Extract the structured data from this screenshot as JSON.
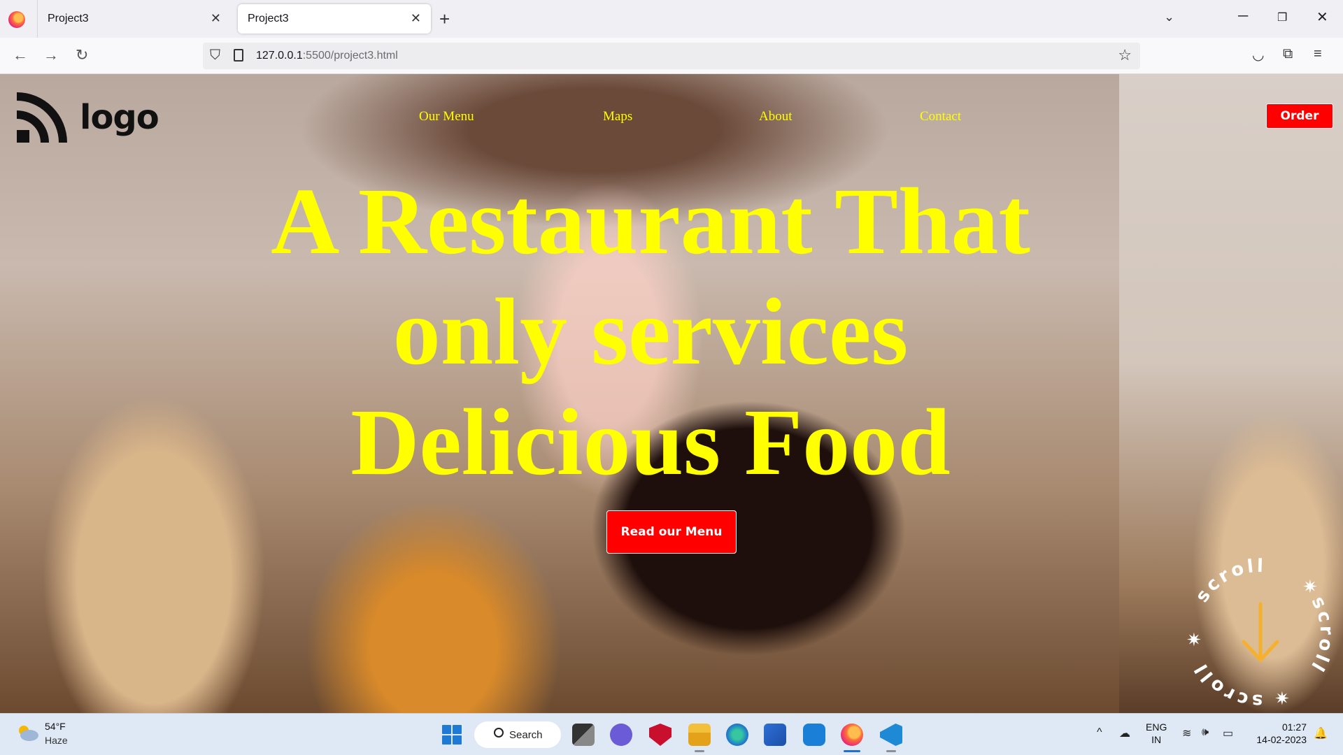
{
  "browser": {
    "tabs": [
      {
        "title": "Project3",
        "active": false
      },
      {
        "title": "Project3",
        "active": true
      }
    ],
    "url_host": "127.0.0.1",
    "url_rest": ":5500/project3.html"
  },
  "site": {
    "logo_text": "logo",
    "nav": [
      "Our Menu",
      "Maps",
      "About",
      "Contact"
    ],
    "order_label": "Order",
    "headline": [
      "A Restaurant That",
      "only services",
      "Delicious Food"
    ],
    "cta_label": "Read our Menu",
    "scroll_text": "scroll",
    "colors": {
      "accent": "#ffff00",
      "button": "#ff0000"
    }
  },
  "taskbar": {
    "weather_temp": "54°F",
    "weather_desc": "Haze",
    "search_label": "Search",
    "lang_line1": "ENG",
    "lang_line2": "IN",
    "time": "01:27",
    "date": "14-02-2023"
  }
}
